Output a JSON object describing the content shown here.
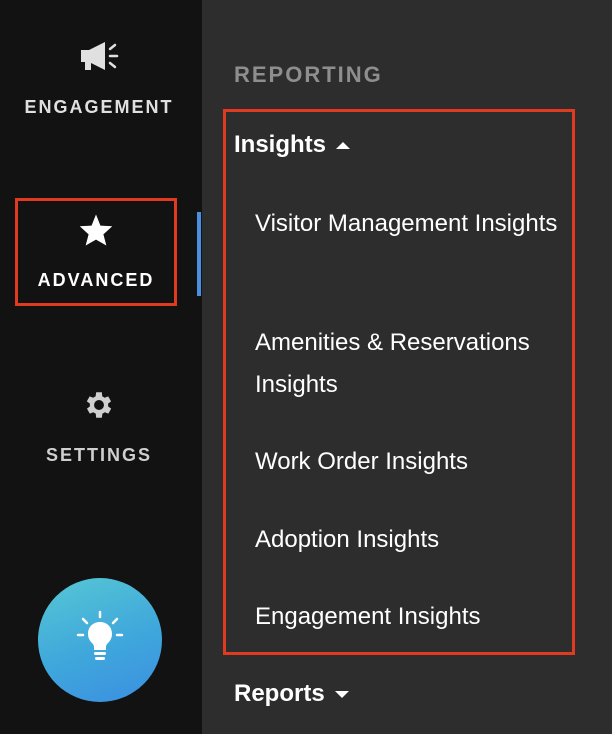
{
  "rail": {
    "engagement_label": "ENGAGEMENT",
    "advanced_label": "ADVANCED",
    "settings_label": "SETTINGS",
    "fab_icon": "lightbulb-icon"
  },
  "panel": {
    "section_title": "REPORTING",
    "insights": {
      "label": "Insights",
      "items": [
        "Visitor Management Insights",
        "Amenities & Reservations Insights",
        "Work Order Insights",
        "Adoption Insights",
        "Engagement Insights"
      ]
    },
    "reports": {
      "label": "Reports"
    }
  },
  "colors": {
    "rail_bg": "#121212",
    "panel_bg": "#2d2d2d",
    "highlight_border": "#e03a20",
    "active_indicator": "#4a90e2"
  }
}
